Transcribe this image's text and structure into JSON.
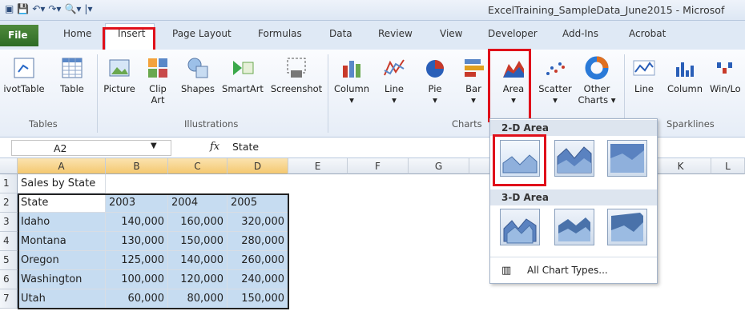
{
  "window": {
    "title": "ExcelTraining_SampleData_June2015 - Microsof"
  },
  "tabs": [
    {
      "label": "File"
    },
    {
      "label": "Home"
    },
    {
      "label": "Insert"
    },
    {
      "label": "Page Layout"
    },
    {
      "label": "Formulas"
    },
    {
      "label": "Data"
    },
    {
      "label": "Review"
    },
    {
      "label": "View"
    },
    {
      "label": "Developer"
    },
    {
      "label": "Add-Ins"
    },
    {
      "label": "Acrobat"
    }
  ],
  "ribbon": {
    "tables": {
      "pivot": "ivotTable",
      "table": "Table",
      "group": "Tables"
    },
    "illustrations": {
      "picture": "Picture",
      "clip1": "Clip",
      "clip2": "Art",
      "shapes": "Shapes",
      "smartart": "SmartArt",
      "screenshot": "Screenshot",
      "group": "Illustrations"
    },
    "charts": {
      "column": "Column",
      "line": "Line",
      "pie": "Pie",
      "bar": "Bar",
      "area": "Area",
      "scatter": "Scatter",
      "other1": "Other",
      "other2": "Charts",
      "group": "Charts"
    },
    "sparklines": {
      "line": "Line",
      "column": "Column",
      "winloss": "Win/Lo",
      "group": "Sparklines"
    }
  },
  "formula_bar": {
    "name_box": "A2",
    "fx": "fx",
    "value": "State"
  },
  "columns": [
    "A",
    "B",
    "C",
    "D",
    "E",
    "F",
    "G",
    "K",
    "L"
  ],
  "rows": [
    "1",
    "2",
    "3",
    "4",
    "5",
    "6",
    "7"
  ],
  "sheet": {
    "a1": "Sales by State",
    "header": [
      "State",
      "2003",
      "2004",
      "2005"
    ],
    "data": [
      [
        "Idaho",
        "140,000",
        "160,000",
        "320,000"
      ],
      [
        "Montana",
        "130,000",
        "150,000",
        "280,000"
      ],
      [
        "Oregon",
        "125,000",
        "140,000",
        "260,000"
      ],
      [
        "Washington",
        "100,000",
        "120,000",
        "240,000"
      ],
      [
        "Utah",
        "60,000",
        "80,000",
        "150,000"
      ]
    ]
  },
  "dropdown": {
    "section1": "2-D Area",
    "section2": "3-D Area",
    "all_types": "All Chart Types..."
  },
  "colors": {
    "highlight": "#c6dcf1",
    "callout": "#e0101a",
    "file_tab": "#2e6b25"
  }
}
